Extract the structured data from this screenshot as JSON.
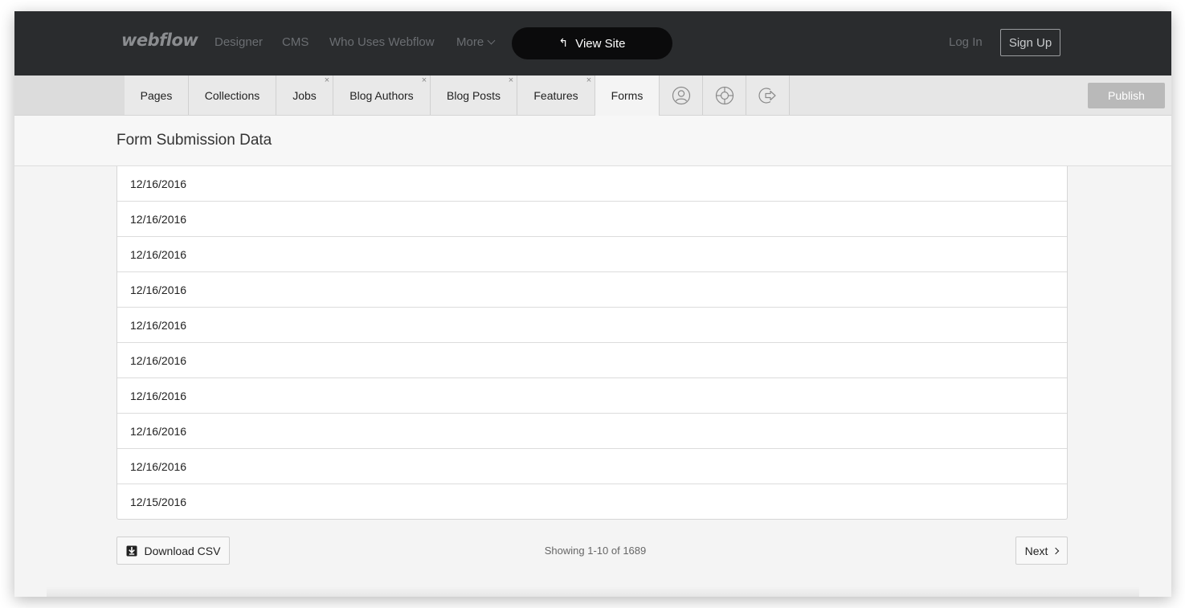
{
  "topnav": {
    "logo": "webflow",
    "links": [
      "Designer",
      "CMS",
      "Who Uses Webflow",
      "More"
    ],
    "view_site_label": "View Site",
    "login_label": "Log In",
    "signup_label": "Sign Up"
  },
  "tabs": [
    {
      "label": "Pages",
      "closable": false
    },
    {
      "label": "Collections",
      "closable": false
    },
    {
      "label": "Jobs",
      "closable": true
    },
    {
      "label": "Blog Authors",
      "closable": true
    },
    {
      "label": "Blog Posts",
      "closable": true
    },
    {
      "label": "Features",
      "closable": true
    },
    {
      "label": "Forms",
      "closable": false,
      "active": true
    }
  ],
  "tab_icons": [
    "user-icon",
    "help-lifebuoy-icon",
    "logout-icon"
  ],
  "publish_label": "Publish",
  "page_title": "Form Submission Data",
  "rows": [
    "12/16/2016",
    "12/16/2016",
    "12/16/2016",
    "12/16/2016",
    "12/16/2016",
    "12/16/2016",
    "12/16/2016",
    "12/16/2016",
    "12/16/2016",
    "12/15/2016"
  ],
  "footer": {
    "download_label": "Download CSV",
    "showing_text": "Showing 1-10 of 1689",
    "next_label": "Next"
  },
  "colors": {
    "topnav_bg": "#2a2c2e",
    "view_site_bg": "#0b0b0c",
    "publish_bg": "#b9b9b9"
  }
}
